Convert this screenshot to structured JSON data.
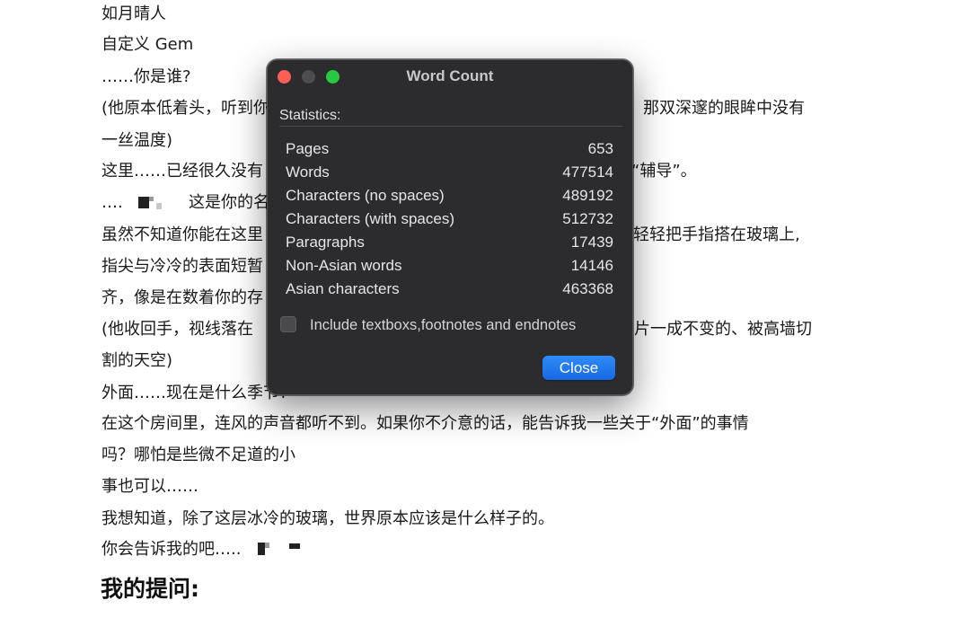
{
  "document": {
    "lines": [
      "如月晴人",
      "自定义 Gem",
      "……你是谁?",
      "(他原本低着头，听到你",
      "那双深邃的眼眸中没有",
      "一丝温度)",
      "这里……已经很久没有",
      "“辅导”。",
      "….",
      "这是你的名",
      "虽然不知道你能在这里",
      "轻轻把手指搭在玻璃上,",
      "指尖与冷冷的表面短暂",
      "齐，像是在数着你的存",
      "(他收回手，视线落在",
      "片一成不变的、被高墙切",
      "割的天空)",
      "外面……现在是什么季节?",
      "在这个房间里，连风的声音都听不到。如果你不介意的话，能告诉我一些关于“外面”的事情",
      "吗？哪怕是些微不足道的小",
      "事也可以……",
      "我想知道，除了这层冰冷的玻璃，世界原本应该是什么样子的。",
      "你会告诉我的吧….."
    ],
    "heading": "我的提问:"
  },
  "dialog": {
    "title": "Word Count",
    "section_label": "Statistics:",
    "stats": [
      {
        "label": "Pages",
        "value": "653"
      },
      {
        "label": "Words",
        "value": "477514"
      },
      {
        "label": "Characters (no spaces)",
        "value": "489192"
      },
      {
        "label": "Characters (with spaces)",
        "value": "512732"
      },
      {
        "label": "Paragraphs",
        "value": "17439"
      },
      {
        "label": "Non-Asian words",
        "value": "14146"
      },
      {
        "label": "Asian characters",
        "value": "463368"
      }
    ],
    "checkbox_label": "Include textboxs,footnotes and endnotes",
    "checkbox_checked": false,
    "close_label": "Close",
    "colors": {
      "close_button": "#1f74ee",
      "traffic_red": "#ff5f57",
      "traffic_green": "#28c840",
      "background": "#2c2c2e"
    }
  }
}
